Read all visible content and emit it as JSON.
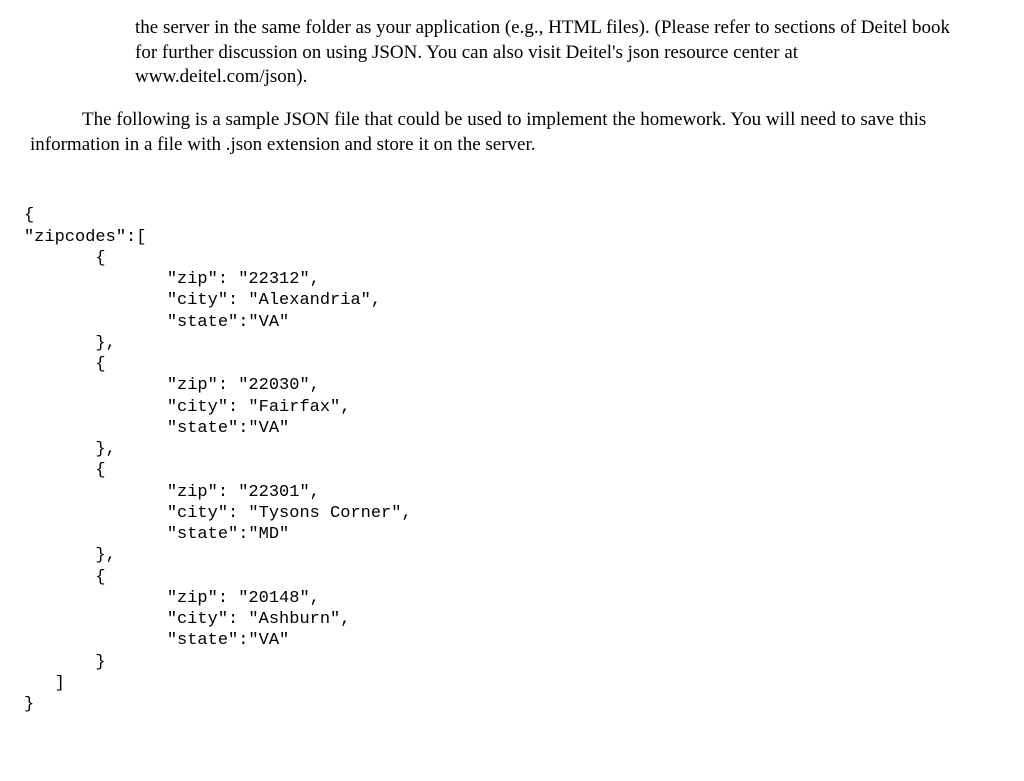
{
  "para1": "the server in the same folder as your application (e.g., HTML files). (Please refer to sections of Deitel book for further discussion on using JSON. You can also visit Deitel's json resource center at www.deitel.com/json).",
  "para2": "The following is a sample JSON file that could be used to implement the homework. You will need to save this information in a file with .json extension and store it on the server.",
  "code": "{\n\"zipcodes\":[\n       {\n              \"zip\": \"22312\",\n              \"city\": \"Alexandria\",\n              \"state\":\"VA\"\n       },\n       {\n              \"zip\": \"22030\",\n              \"city\": \"Fairfax\",\n              \"state\":\"VA\"\n       },\n       {\n              \"zip\": \"22301\",\n              \"city\": \"Tysons Corner\",\n              \"state\":\"MD\"\n       },\n       {\n              \"zip\": \"20148\",\n              \"city\": \"Ashburn\",\n              \"state\":\"VA\"\n       }\n   ]\n}"
}
